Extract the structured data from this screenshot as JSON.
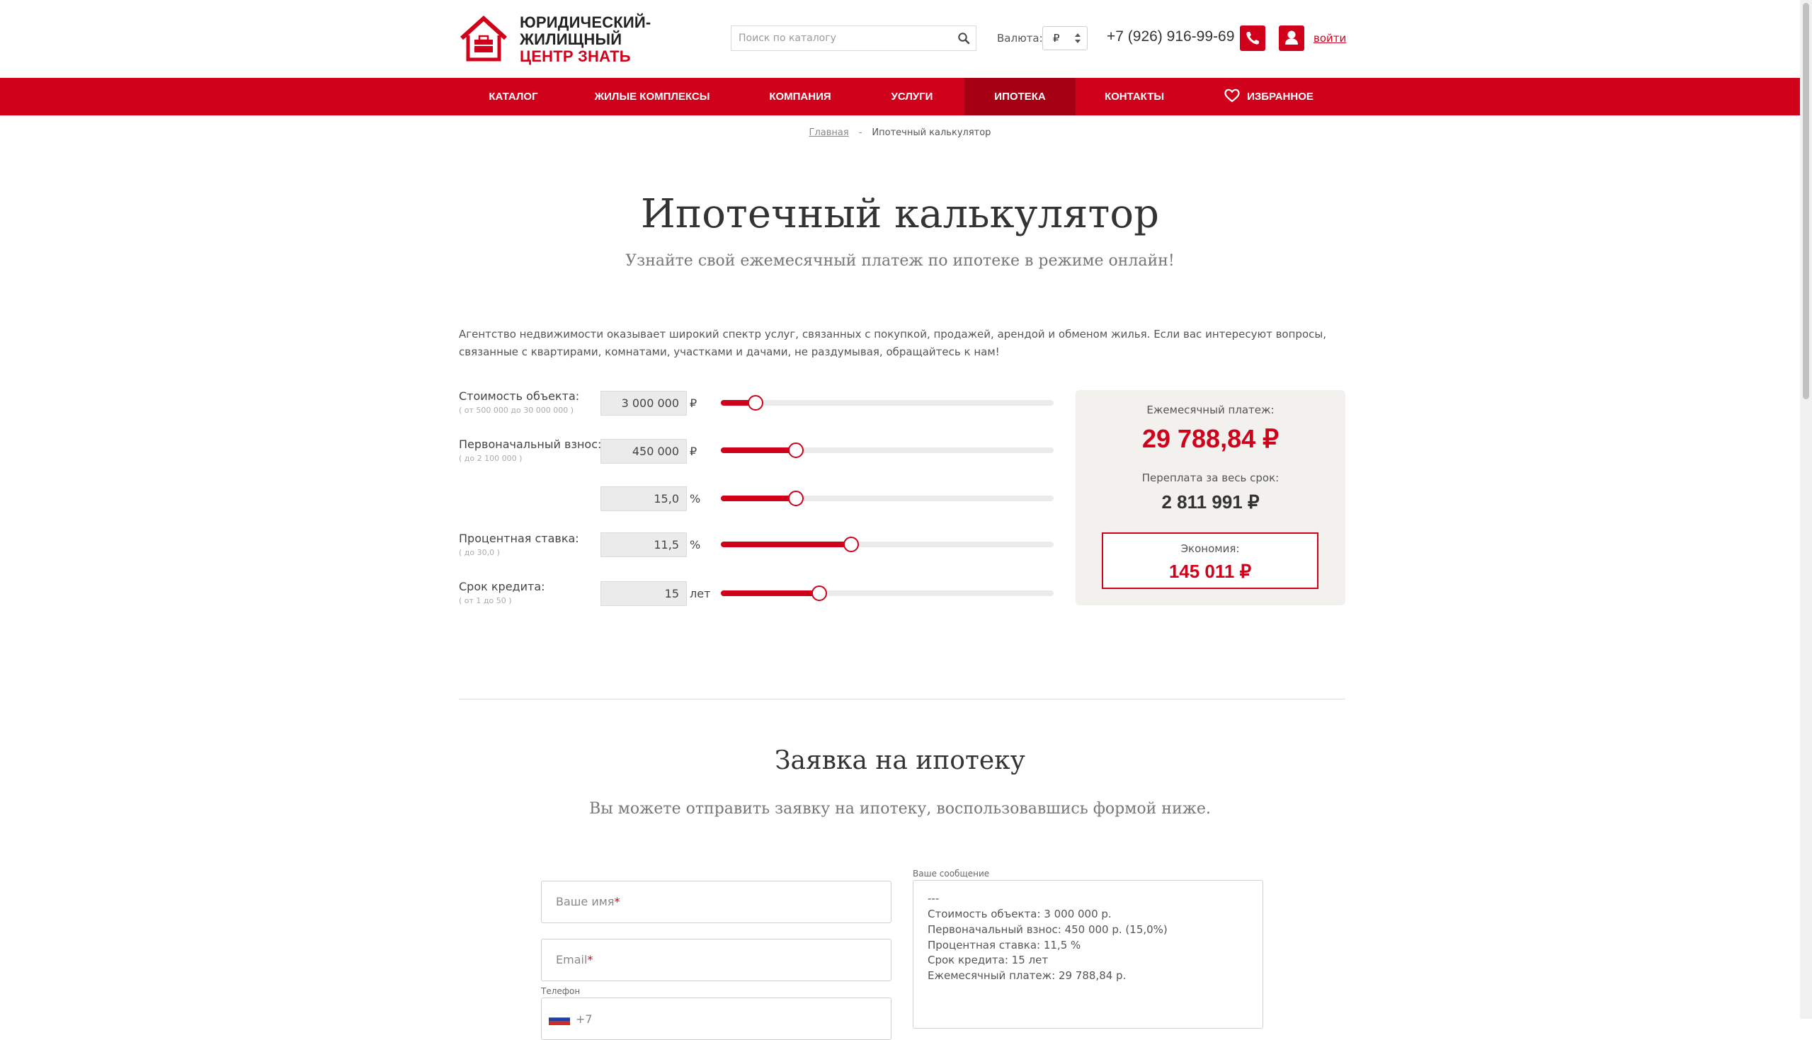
{
  "colors": {
    "brand": "#d0021b",
    "nav_active": "#a60015"
  },
  "header": {
    "logo": {
      "line1": "ЮРИДИЧЕСКИЙ-",
      "line2": "ЖИЛИЩНЫЙ",
      "line3": "ЦЕНТР ЗНАТЬ",
      "icon": "house-briefcase-icon"
    },
    "search": {
      "placeholder": "Поиск по каталогу",
      "icon": "search-icon"
    },
    "currency": {
      "label": "Валюта:",
      "selected": "₽"
    },
    "phone": "+7 (926) 916-99-69",
    "login": "войти"
  },
  "nav": {
    "items": [
      {
        "label": "КАТАЛОГ"
      },
      {
        "label": "ЖИЛЫЕ КОМПЛЕКСЫ"
      },
      {
        "label": "КОМПАНИЯ"
      },
      {
        "label": "УСЛУГИ"
      },
      {
        "label": "ИПОТЕКА",
        "active": true
      },
      {
        "label": "КОНТАКТЫ"
      },
      {
        "label": "ИЗБРАННОЕ",
        "icon": "heart-icon"
      }
    ]
  },
  "breadcrumb": {
    "home": "Главная",
    "separator": "-",
    "current": "Ипотечный калькулятор"
  },
  "page": {
    "title": "Ипотечный калькулятор",
    "subtitle": "Узнайте свой ежемесячный платеж по ипотеке в режиме онлайн!",
    "intro": "Агентство недвижимости оказывает широкий спектр услуг, связанных с покупкой, продажей, арендой и обменом жилья. Если вас интересуют вопросы, связанные с квартирами, комнатами, участками и дачами, не раздумывая, обращайтесь к нам!"
  },
  "calculator": {
    "cost": {
      "label": "Стоимость объекта:",
      "hint": "( от 500 000 до 30 000 000 )",
      "value": "3 000 000",
      "unit": "₽",
      "slider": 0.104
    },
    "down": {
      "label": "Первоначальный взнос:",
      "hint": "( до 2 100 000 )",
      "value": "450 000",
      "unit": "₽",
      "slider": 0.225
    },
    "down_pct": {
      "value": "15,0",
      "unit": "%",
      "slider": 0.225
    },
    "rate": {
      "label": "Процентная ставка:",
      "hint": "( до 30,0 )",
      "value": "11,5",
      "unit": "%",
      "slider": 0.392
    },
    "term": {
      "label": "Срок кредита:",
      "hint": "( от 1 до 50 )",
      "value": "15",
      "unit": "лет",
      "slider": 0.296
    }
  },
  "result": {
    "monthly_label": "Ежемесячный платеж:",
    "monthly_value": "29 788,84 ₽",
    "overpay_label": "Переплата за весь срок:",
    "overpay_value": "2 811 991 ₽",
    "economy_label": "Экономия:",
    "economy_value": "145 011 ₽"
  },
  "form": {
    "title": "Заявка на ипотеку",
    "subtitle": "Вы можете отправить заявку на ипотеку, воспользовавшись формой ниже.",
    "name_placeholder": "Ваше имя",
    "email_placeholder": "Email",
    "required_mark": "*",
    "phone_label": "Телефон",
    "phone_code": "+7",
    "message_label": "Ваше сообщение",
    "message_lines": [
      "---",
      "Стоимость объекта: 3 000 000 р.",
      "Первоначальный взнос: 450 000 р. (15,0%)",
      "Процентная ставка: 11,5 %",
      "Срок кредита: 15 лет",
      "Ежемесячный платеж: 29 788,84 р."
    ]
  }
}
